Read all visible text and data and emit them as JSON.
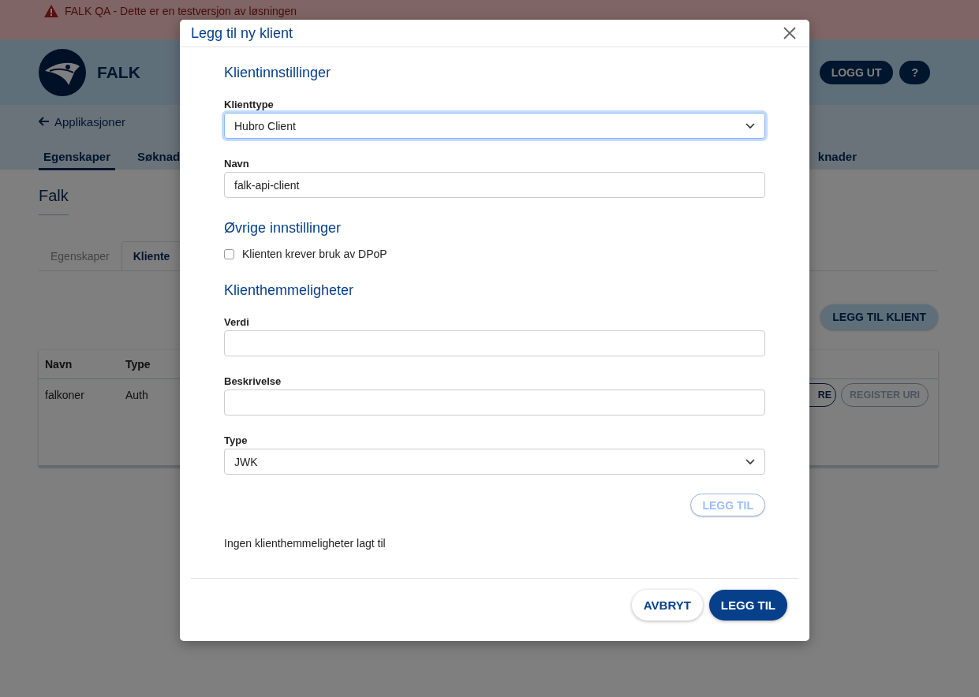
{
  "banner": {
    "text": "FALK QA - Dette er en testversjon av løsningen"
  },
  "header": {
    "app_name": "FALK",
    "buttons": [
      {
        "label": "LOGG UT"
      },
      {
        "label": "?"
      }
    ]
  },
  "nav": {
    "back_link": "Applikasjoner",
    "tabs": [
      {
        "label": "Egenskaper",
        "selected": true
      },
      {
        "label": "Søknad",
        "selected": false
      },
      {
        "label": "knader",
        "selected": false
      }
    ]
  },
  "page": {
    "title": "Falk",
    "tabs": [
      {
        "label": "Egenskaper",
        "selected": false
      },
      {
        "label": "Kliente",
        "selected": true
      }
    ],
    "add_button": "LEGG TIL KLIENT",
    "table": {
      "columns": [
        "Navn",
        "Type"
      ],
      "rows": [
        {
          "cells": [
            "falkoner",
            "Auth"
          ],
          "actions": [
            {
              "label": "RE",
              "disabled": false
            },
            {
              "label": "REGISTER URI",
              "disabled": true
            }
          ]
        }
      ]
    }
  },
  "dialog": {
    "title": "Legg til ny klient",
    "sections": [
      {
        "heading": "Klientinnstillinger",
        "fields": [
          {
            "kind": "select",
            "label": "Klienttype",
            "value": "Hubro Client",
            "focused": true
          },
          {
            "kind": "text",
            "label": "Navn",
            "value": "falk-api-client",
            "focused": false
          }
        ]
      },
      {
        "heading": "Øvrige innstillinger",
        "fields": [
          {
            "kind": "checkbox",
            "label": "Klienten krever bruk av DPoP",
            "checked": false
          }
        ]
      },
      {
        "heading": "Klienthemmeligheter",
        "fields": [
          {
            "kind": "text",
            "label": "Verdi",
            "focused": false
          },
          {
            "kind": "text",
            "label": "Beskrivelse",
            "focused": false
          },
          {
            "kind": "select",
            "label": "Type",
            "value": "JWK",
            "focused": false
          }
        ],
        "add_button": {
          "label": "LEGG TIL",
          "disabled": true
        },
        "empty_message": "Ingen klienthemmeligheter lagt til"
      }
    ],
    "footer_buttons": [
      {
        "label": "AVBRYT",
        "kind": "secondary"
      },
      {
        "label": "LEGG TIL",
        "kind": "primary"
      }
    ]
  }
}
